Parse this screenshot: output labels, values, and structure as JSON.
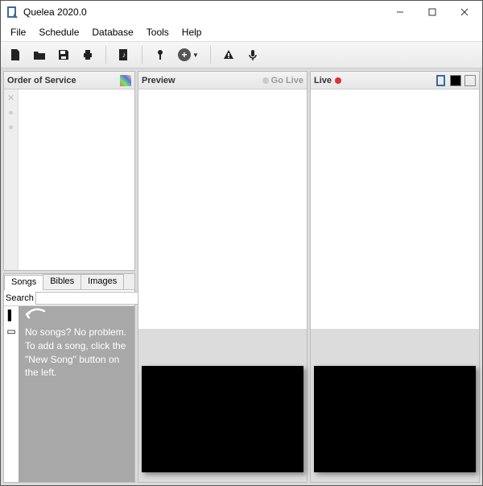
{
  "window": {
    "title": "Quelea 2020.0"
  },
  "menu": {
    "file": "File",
    "schedule": "Schedule",
    "database": "Database",
    "tools": "Tools",
    "help": "Help"
  },
  "panels": {
    "order": {
      "title": "Order of Service"
    },
    "preview": {
      "title": "Preview",
      "golive_label": "Go Live"
    },
    "live": {
      "title": "Live"
    }
  },
  "library": {
    "tabs": {
      "songs": "Songs",
      "bibles": "Bibles",
      "images": "Images"
    },
    "search_label": "Search",
    "search_value": "",
    "empty_hint": "No songs? No problem. To add a song, click the \"New Song\" button on the left."
  }
}
